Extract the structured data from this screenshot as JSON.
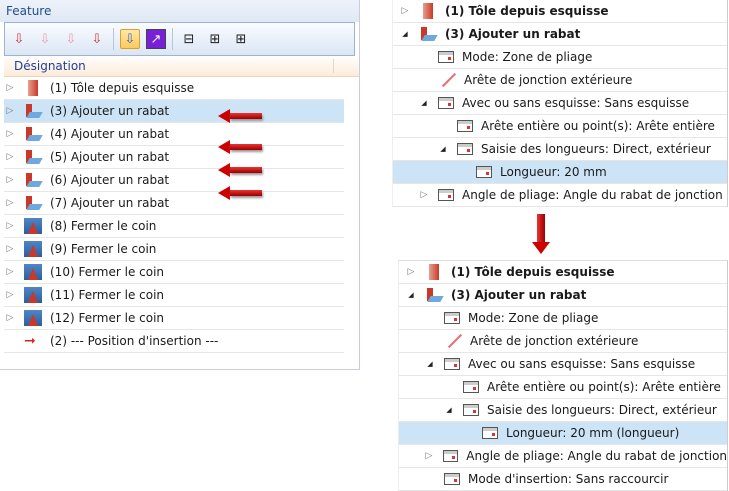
{
  "left": {
    "title": "Feature",
    "column": "Désignation",
    "toolbar": [
      "insert-icon",
      "insert-disabled-icon",
      "insert-disabled-2-icon",
      "insert-sketch-icon",
      "insert-active-icon",
      "jump-icon",
      "collapse-up-icon",
      "expand-2-icon",
      "expand-all-icon"
    ],
    "rows": [
      {
        "label": "(1) Tôle depuis esquisse",
        "icon": "sheet"
      },
      {
        "label": "(3) Ajouter un rabat",
        "icon": "flange"
      },
      {
        "label": "(4) Ajouter un rabat",
        "icon": "flange"
      },
      {
        "label": "(5) Ajouter un rabat",
        "icon": "flange"
      },
      {
        "label": "(6) Ajouter un rabat",
        "icon": "flange"
      },
      {
        "label": "(7) Ajouter un rabat",
        "icon": "flange"
      },
      {
        "label": "(8) Fermer le coin",
        "icon": "corner"
      },
      {
        "label": "(9) Fermer le coin",
        "icon": "corner"
      },
      {
        "label": "(10) Fermer le coin",
        "icon": "corner"
      },
      {
        "label": "(11) Fermer le coin",
        "icon": "corner"
      },
      {
        "label": "(12) Fermer le coin",
        "icon": "corner"
      },
      {
        "label": "(2) --- Position  d'insertion ---",
        "icon": "arrow"
      }
    ]
  },
  "top": {
    "rows": [
      {
        "label": "(1) Tôle depuis esquisse"
      },
      {
        "label": "(3) Ajouter un rabat"
      },
      {
        "label": "Mode: Zone de pliage"
      },
      {
        "label": "Arête de jonction extérieure"
      },
      {
        "label": "Avec ou sans esquisse: Sans esquisse"
      },
      {
        "label": "Arête entière ou point(s): Arête entière"
      },
      {
        "label": "Saisie des longueurs: Direct, extérieur"
      },
      {
        "label": "Longueur: 20 mm"
      },
      {
        "label": "Angle de pliage: Angle du rabat de jonction"
      }
    ]
  },
  "bottom": {
    "rows": [
      {
        "label": "(1) Tôle depuis esquisse"
      },
      {
        "label": "(3) Ajouter un rabat"
      },
      {
        "label": "Mode: Zone de pliage"
      },
      {
        "label": "Arête de jonction extérieure"
      },
      {
        "label": "Avec ou sans esquisse: Sans esquisse"
      },
      {
        "label": "Arête entière ou point(s): Arête entière"
      },
      {
        "label": "Saisie des longueurs: Direct, extérieur"
      },
      {
        "label": "Longueur: 20 mm (longueur)"
      },
      {
        "label": "Angle de pliage: Angle du rabat de jonction"
      },
      {
        "label": "Mode d'insertion: Sans raccourcir"
      }
    ]
  }
}
